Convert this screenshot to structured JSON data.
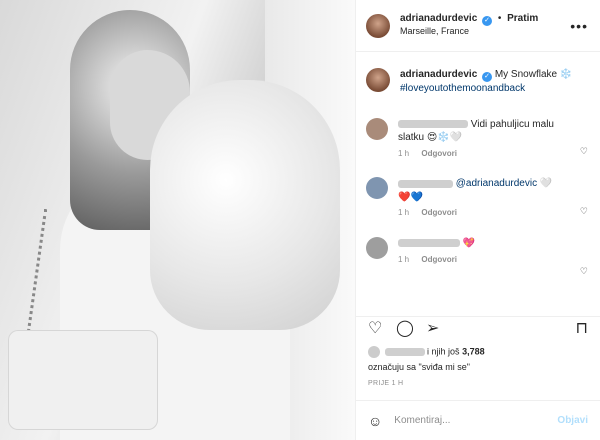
{
  "header": {
    "username": "adrianadurdevic",
    "follow_label": "Pratim",
    "location": "Marseille, France"
  },
  "caption": {
    "username": "adrianadurdevic",
    "text": "My Snowflake ❄️",
    "hashtag": "#loveyoutothemoonandback"
  },
  "comments": [
    {
      "text": "Vidi pahuljicu malu slatku 😍❄️🤍",
      "time": "1 h",
      "reply_label": "Odgovori"
    },
    {
      "text": "@adrianadurdevic 🤍",
      "text2": "❤️💙",
      "time": "1 h",
      "reply_label": "Odgovori"
    },
    {
      "text": "💖",
      "time": "1 h",
      "reply_label": "Odgovori"
    }
  ],
  "likes": {
    "prefix": "i njih još",
    "count": "3,788",
    "line2": "označuju sa \"sviđa mi se\""
  },
  "timestamp": "PRIJE 1 H",
  "add_comment": {
    "placeholder": "Komentiraj...",
    "post_label": "Objavi"
  },
  "icons": {
    "verified": "verified-badge-icon",
    "like": "heart-icon",
    "comment": "comment-icon",
    "share": "send-icon",
    "save": "bookmark-icon",
    "emoji": "emoji-icon",
    "more": "more-options-icon"
  }
}
